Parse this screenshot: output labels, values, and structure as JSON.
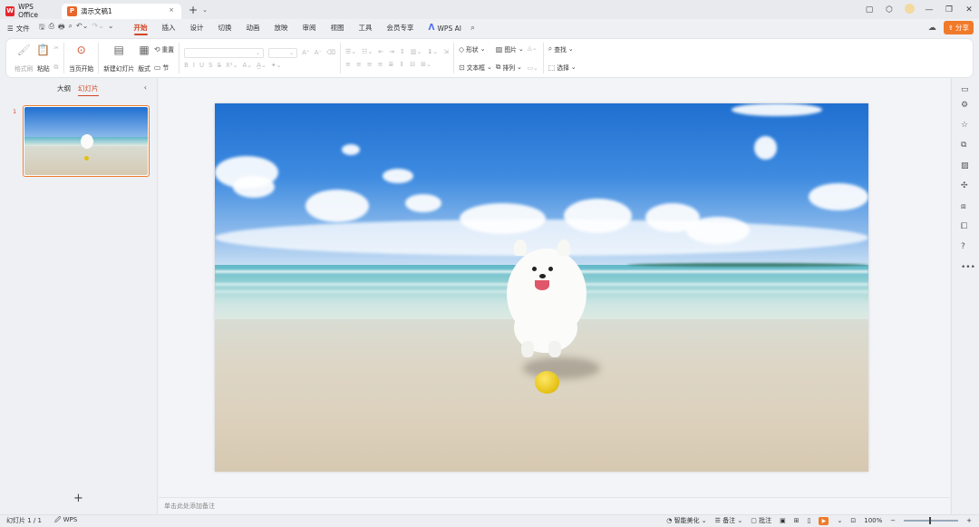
{
  "titlebar": {
    "home_tab": "WPS Office",
    "doc_tab": "演示文稿1",
    "close": "×",
    "new_tab": "+",
    "new_tab_caret": "⌄"
  },
  "menu": {
    "file": "文件",
    "tabs": [
      "开始",
      "插入",
      "设计",
      "切换",
      "动画",
      "放映",
      "审阅",
      "视图",
      "工具",
      "会员专享"
    ],
    "active_tab": "开始",
    "wps_ai": "WPS AI",
    "share": "分享"
  },
  "ribbon": {
    "format_painter": "格式刷",
    "paste": "粘贴",
    "from_current": "当页开始",
    "new_slide": "新建幻灯片",
    "layout": "版式",
    "reset": "重置",
    "section": "节",
    "shapes": "形状",
    "picture": "图片",
    "textbox": "文本框",
    "arrange": "排列",
    "find": "查找",
    "select": "选择"
  },
  "left_panel": {
    "outline_tab": "大纲",
    "slides_tab": "幻灯片",
    "slide_number": "1",
    "add": "+"
  },
  "notes": {
    "placeholder": "单击此处添加备注"
  },
  "status": {
    "slide_count": "幻灯片 1 / 1",
    "theme": "WPS",
    "beautify": "智能美化",
    "notes": "备注",
    "comments": "批注",
    "zoom": "100%"
  },
  "colors": {
    "accent": "#d24726",
    "orange": "#f07a2a"
  }
}
